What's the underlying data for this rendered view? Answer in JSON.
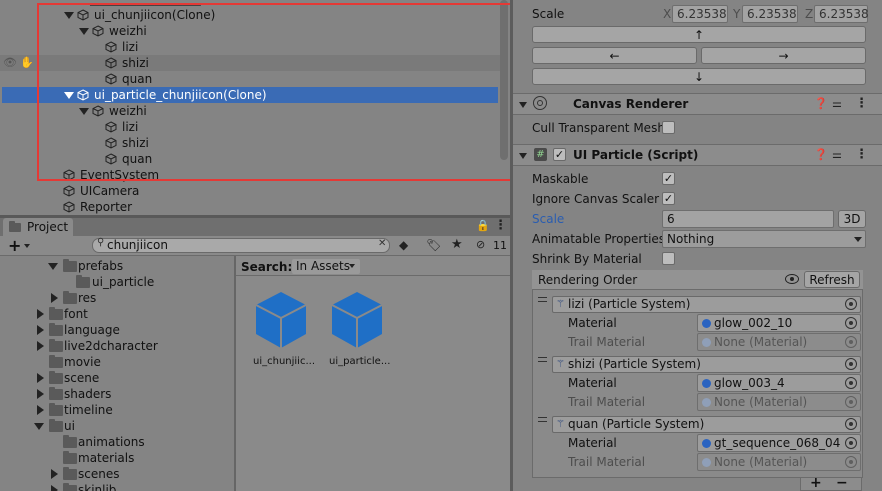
{
  "hierarchy": {
    "items": [
      {
        "label": "ui_chunjiicon(Clone)"
      },
      {
        "label": "weizhi"
      },
      {
        "label": "lizi"
      },
      {
        "label": "shizi"
      },
      {
        "label": "quan"
      },
      {
        "label": "ui_particle_chunjiicon(Clone)"
      },
      {
        "label": "weizhi"
      },
      {
        "label": "lizi"
      },
      {
        "label": "shizi"
      },
      {
        "label": "quan"
      },
      {
        "label": "EventSystem"
      },
      {
        "label": "UICamera"
      },
      {
        "label": "Reporter"
      }
    ],
    "selected_index": 5,
    "highlight_color": "#e53935",
    "selection_color": "#3a6bb5"
  },
  "project": {
    "tab_label": "Project",
    "add_label": "+",
    "search_value": "chunjiicon",
    "hidden_count": "11",
    "search_label": "Search:",
    "scope_label": "In Assets",
    "tree": [
      {
        "label": "prefabs"
      },
      {
        "label": "ui_particle"
      },
      {
        "label": "res"
      },
      {
        "label": "font"
      },
      {
        "label": "language"
      },
      {
        "label": "live2dcharacter"
      },
      {
        "label": "movie"
      },
      {
        "label": "scene"
      },
      {
        "label": "shaders"
      },
      {
        "label": "timeline"
      },
      {
        "label": "ui"
      },
      {
        "label": "animations"
      },
      {
        "label": "materials"
      },
      {
        "label": "scenes"
      },
      {
        "label": "skinlib"
      }
    ],
    "assets": [
      {
        "label": "ui_chunjiic..."
      },
      {
        "label": "ui_particle..."
      }
    ],
    "asset_color": "#1f6fc6"
  },
  "inspector": {
    "scale_label": "Scale",
    "scale": {
      "x_label": "X",
      "x": "6.23538",
      "y_label": "Y",
      "y": "6.23538",
      "z_label": "Z",
      "z": "6.23538"
    },
    "arrows": {
      "up": "↑",
      "left": "←",
      "right": "→",
      "down": "↓"
    },
    "canvas_renderer": {
      "title": "Canvas Renderer",
      "cull_label": "Cull Transparent Mesh"
    },
    "ui_particle": {
      "title": "UI Particle (Script)",
      "maskable_label": "Maskable",
      "ignore_label": "Ignore Canvas Scaler",
      "scale_label": "Scale",
      "scale_value": "6",
      "btn_3d": "3D",
      "anim_label": "Animatable Properties",
      "anim_value": "Nothing",
      "shrink_label": "Shrink By Material",
      "rendering_order_label": "Rendering Order",
      "refresh_label": "Refresh",
      "systems": [
        {
          "name": "lizi (Particle System)",
          "material_label": "Material",
          "material": "glow_002_10",
          "trail_label": "Trail Material",
          "trail": "None (Material)"
        },
        {
          "name": "shizi (Particle System)",
          "material_label": "Material",
          "material": "glow_003_4",
          "trail_label": "Trail Material",
          "trail": "None (Material)"
        },
        {
          "name": "quan (Particle System)",
          "material_label": "Material",
          "material": "gt_sequence_068_04",
          "trail_label": "Trail Material",
          "trail": "None (Material)"
        }
      ],
      "plus": "+",
      "minus": "−"
    },
    "link_color": "#2a5db0"
  }
}
